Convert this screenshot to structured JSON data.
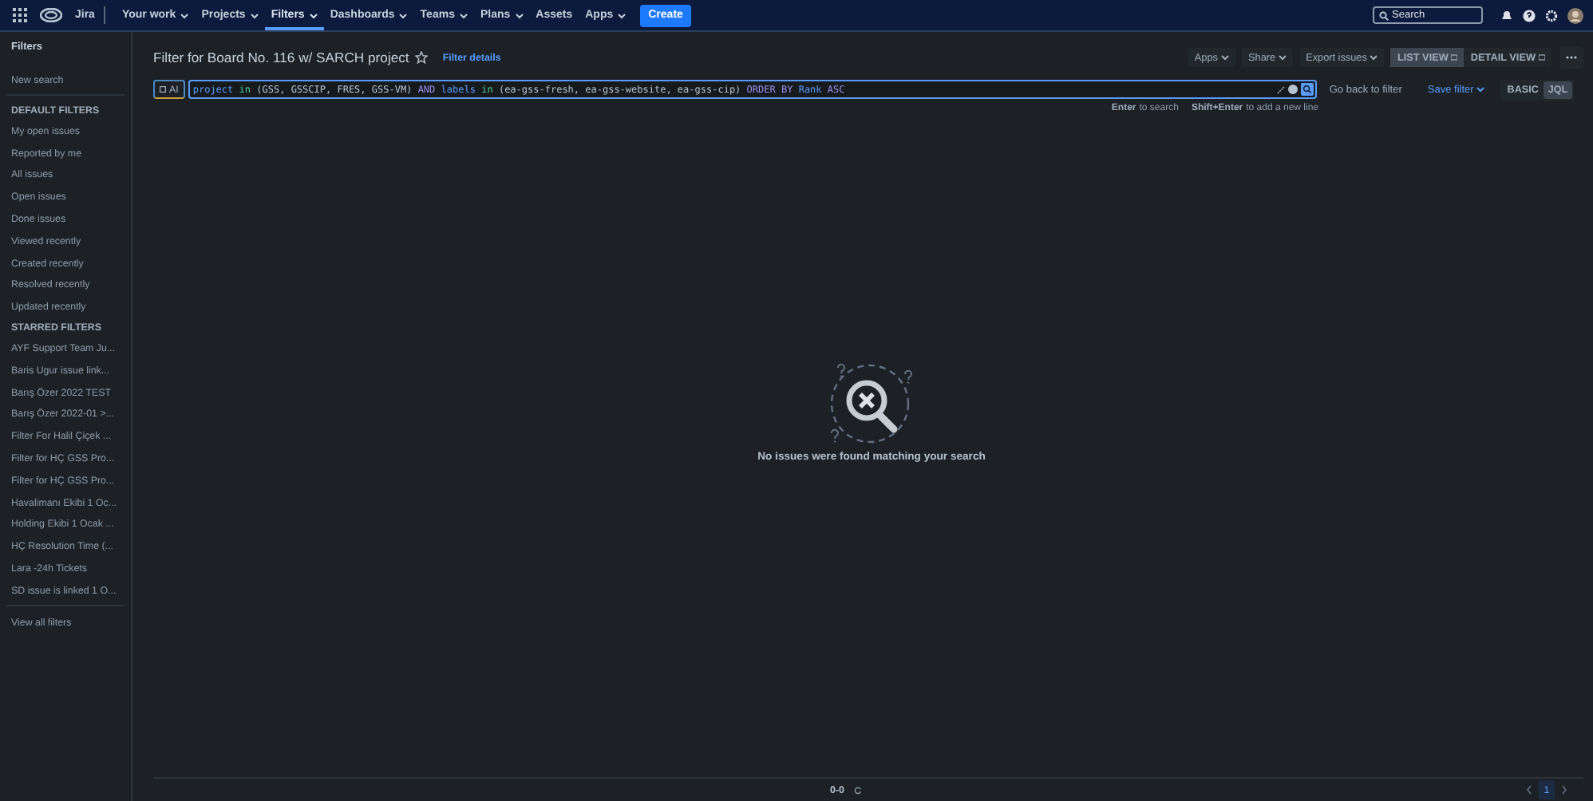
{
  "topbar": {
    "product": "Jira",
    "nav": [
      {
        "label": "Your work",
        "dropdown": true,
        "selected": false
      },
      {
        "label": "Projects",
        "dropdown": true,
        "selected": false
      },
      {
        "label": "Filters",
        "dropdown": true,
        "selected": true
      },
      {
        "label": "Dashboards",
        "dropdown": true,
        "selected": false
      },
      {
        "label": "Teams",
        "dropdown": true,
        "selected": false
      },
      {
        "label": "Plans",
        "dropdown": true,
        "selected": false
      },
      {
        "label": "Assets",
        "dropdown": false,
        "selected": false
      },
      {
        "label": "Apps",
        "dropdown": true,
        "selected": false
      }
    ],
    "create": "Create",
    "search": {
      "placeholder": "Search"
    }
  },
  "sidebar": {
    "title": "Filters",
    "new_search": "New search",
    "sections": [
      {
        "title": "DEFAULT FILTERS",
        "items": [
          "My open issues",
          "Reported by me",
          "All issues",
          "Open issues",
          "Done issues",
          "Viewed recently",
          "Created recently",
          "Resolved recently",
          "Updated recently"
        ]
      },
      {
        "title": "STARRED FILTERS",
        "items": [
          "AYF Support Team Ju...",
          "Baris Ugur issue link...",
          "Barış Özer 2022 TEST",
          "Barış Özer 2022-01 >...",
          "Filter For Halil Çiçek ...",
          "Filter for HÇ GSS Pro...",
          "Filter for HÇ GSS Pro...",
          "Havalimanı Ekibi 1 Oc...",
          "Holding Ekibi 1 Ocak ...",
          "HÇ Resolution Time (...",
          "Lara -24h Tickets",
          "SD issue is linked 1 O..."
        ]
      }
    ],
    "view_all": "View all filters"
  },
  "header": {
    "title": "Filter for Board No. 116 w/ SARCH project",
    "starred": false,
    "details": "Filter details",
    "actions": [
      "Apps",
      "Share",
      "Export issues"
    ],
    "views": [
      {
        "label": "LIST VIEW",
        "selected": true
      },
      {
        "label": "DETAIL VIEW",
        "selected": false
      }
    ]
  },
  "query": {
    "ai": "AI",
    "tokens": [
      {
        "text": "project",
        "kind": "field"
      },
      {
        "text": "in",
        "kind": "operator"
      },
      {
        "text": "(GSS, GSSCIP, FRES, GSS-VM)",
        "kind": "value"
      },
      {
        "text": "AND",
        "kind": "keyword"
      },
      {
        "text": "labels",
        "kind": "field"
      },
      {
        "text": "in",
        "kind": "operator"
      },
      {
        "text": "(ea-gss-fresh, ea-gss-website, ea-gss-cip)",
        "kind": "value"
      },
      {
        "text": "ORDER BY",
        "kind": "keyword"
      },
      {
        "text": "Rank",
        "kind": "field"
      },
      {
        "text": "ASC",
        "kind": "keyword"
      }
    ],
    "back": "Go back to filter",
    "save": "Save filter",
    "modes": [
      {
        "label": "BASIC",
        "selected": false
      },
      {
        "label": "JQL",
        "selected": true
      }
    ],
    "hint_key1": "Enter",
    "hint_text1": "to search",
    "hint_key2": "Shift+Enter",
    "hint_text2": "to add a new line"
  },
  "empty_message": "No issues were found matching your search",
  "footer": {
    "range": "0-0",
    "pages": [
      {
        "label": "1",
        "selected": true
      }
    ]
  }
}
